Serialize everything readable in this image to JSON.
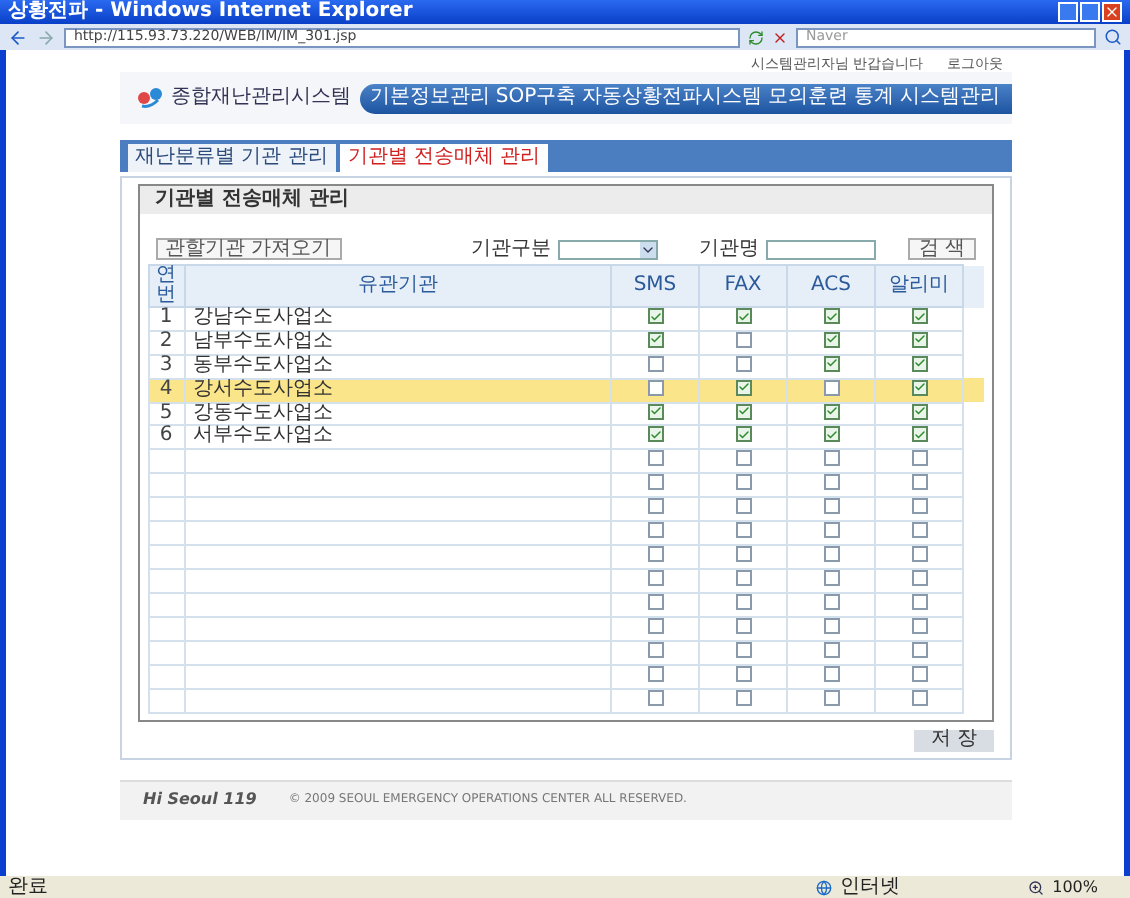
{
  "window": {
    "title": "상황전파 - Windows Internet Explorer"
  },
  "address_bar": {
    "url": "http://115.93.73.220/WEB/IM/IM_301.jsp"
  },
  "search": {
    "placeholder": "Naver"
  },
  "header": {
    "greeting": "시스템관리자님 반갑습니다",
    "logout": "로그아웃",
    "logo": "종합재난관리시스템"
  },
  "nav": [
    {
      "label": "기본정보관리"
    },
    {
      "label": "SOP구축"
    },
    {
      "label": "자동상황전파시스템"
    },
    {
      "label": "모의훈련"
    },
    {
      "label": "통계"
    },
    {
      "label": "시스템관리"
    }
  ],
  "tabs": [
    {
      "label": "재난분류별 기관 관리",
      "selected": false
    },
    {
      "label": "기관별 전송매체 관리",
      "selected": true
    }
  ],
  "panel": {
    "title": "기관별 전송매체 관리",
    "import_button": "관할기관 가져오기",
    "filter_label": "기관구분",
    "name_label": "기관명",
    "search_button": "검 색"
  },
  "table": {
    "columns": [
      "연번",
      "유관기관",
      "SMS",
      "FAX",
      "ACS",
      "알리미"
    ],
    "rows": [
      {
        "no": "1",
        "name": "강남수도사업소",
        "selected": false,
        "sms": true,
        "fax": true,
        "acs": true,
        "alarm": true
      },
      {
        "no": "2",
        "name": "남부수도사업소",
        "selected": false,
        "sms": true,
        "fax": false,
        "acs": true,
        "alarm": true
      },
      {
        "no": "3",
        "name": "동부수도사업소",
        "selected": false,
        "sms": false,
        "fax": false,
        "acs": true,
        "alarm": true
      },
      {
        "no": "4",
        "name": "강서수도사업소",
        "selected": true,
        "sms": false,
        "fax": true,
        "acs": false,
        "alarm": true
      },
      {
        "no": "5",
        "name": "강동수도사업소",
        "selected": false,
        "sms": true,
        "fax": true,
        "acs": true,
        "alarm": true
      },
      {
        "no": "6",
        "name": "서부수도사업소",
        "selected": false,
        "sms": true,
        "fax": true,
        "acs": true,
        "alarm": true
      },
      {
        "selected": false,
        "sms": false,
        "fax": false,
        "acs": false,
        "alarm": false
      },
      {
        "selected": false,
        "sms": false,
        "fax": false,
        "acs": false,
        "alarm": false
      },
      {
        "selected": false,
        "sms": false,
        "fax": false,
        "acs": false,
        "alarm": false
      },
      {
        "selected": false,
        "sms": false,
        "fax": false,
        "acs": false,
        "alarm": false
      },
      {
        "selected": false,
        "sms": false,
        "fax": false,
        "acs": false,
        "alarm": false
      },
      {
        "selected": false,
        "sms": false,
        "fax": false,
        "acs": false,
        "alarm": false
      },
      {
        "selected": false,
        "sms": false,
        "fax": false,
        "acs": false,
        "alarm": false
      },
      {
        "selected": false,
        "sms": false,
        "fax": false,
        "acs": false,
        "alarm": false
      },
      {
        "selected": false,
        "sms": false,
        "fax": false,
        "acs": false,
        "alarm": false
      },
      {
        "selected": false,
        "sms": false,
        "fax": false,
        "acs": false,
        "alarm": false
      },
      {
        "selected": false,
        "sms": false,
        "fax": false,
        "acs": false,
        "alarm": false
      }
    ]
  },
  "save_button": "저 장",
  "footer": {
    "logo": "Hi Seoul 119",
    "copyright": "© 2009 SEOUL EMERGENCY OPERATIONS CENTER ALL RESERVED."
  },
  "status_bar": {
    "status": "완료",
    "zone": "인터넷",
    "zoom": "100%"
  }
}
